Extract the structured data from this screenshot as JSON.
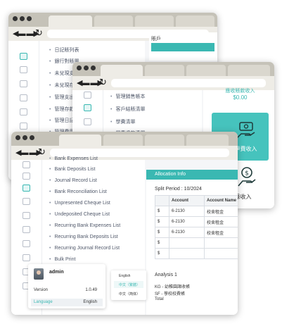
{
  "window_back": {
    "menu": [
      "日記賬列表",
      "銀行對賬單",
      "未兌現支票",
      "未兌現存款",
      "管理支出",
      "管理存款",
      "管理日記",
      "管理費用"
    ],
    "right_label": "賬戶"
  },
  "window_middle": {
    "menu": [
      "管理銷售帳本",
      "客戶結賬清單",
      "學費清單",
      "學費退款清單"
    ],
    "card1": {
      "label": "應收賬款收入",
      "amount": "$0.00"
    },
    "card2_label": "記錄學費收入",
    "card3_label": "記錄收入"
  },
  "window_front": {
    "menu": [
      "Bank Expenses List",
      "Bank Deposits List",
      "Journal Record List",
      "Bank Reconciliation List",
      "Unpresented Cheque List",
      "Undeposited Cheque List",
      "Recurring Bank Expenses List",
      "Recurring Bank Deposits List",
      "Recurring Journal Record List",
      "Bulk Print"
    ],
    "allocation": {
      "header": "Allocation Info",
      "split_period": "Split Period : 10/2024",
      "columns": [
        "",
        "Account",
        "Account Name"
      ],
      "rows": [
        {
          "marker": "$",
          "account": "6-2130",
          "name": "校舍租金"
        },
        {
          "marker": "$",
          "account": "6-2130",
          "name": "校舍租金"
        },
        {
          "marker": "$",
          "account": "6-2130",
          "name": "校舍租金"
        },
        {
          "marker": "$",
          "account": "",
          "name": ""
        },
        {
          "marker": "$",
          "account": "",
          "name": ""
        }
      ],
      "analysis_title": "Analysis 1",
      "analysis_items": [
        "KG - 幼稚園諸收帳",
        "SF - 學校校費帳",
        "Total"
      ]
    }
  },
  "profile": {
    "name": "admin",
    "version_label": "Version",
    "version": "1.0.49",
    "language_label": "Language",
    "language_value": "English"
  },
  "language_menu": {
    "options": [
      "English",
      "中文（繁體）",
      "中文（简体）"
    ],
    "selected": 1
  },
  "colors": {
    "accent": "#3ab8b2",
    "chrome": "#c5c2b8"
  }
}
